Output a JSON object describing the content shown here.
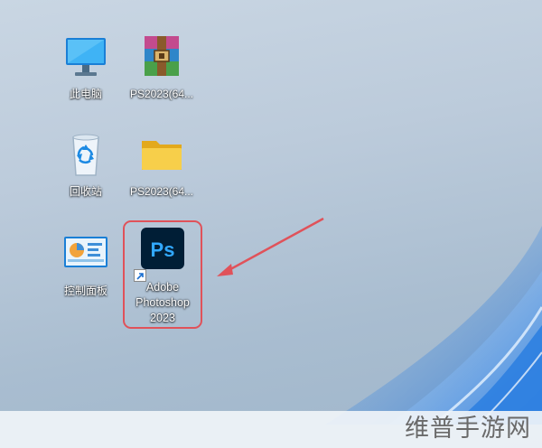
{
  "desktop": {
    "icons": [
      {
        "label": "此电脑",
        "icon": "monitor-icon"
      },
      {
        "label": "PS2023(64...",
        "icon": "archive-icon"
      },
      {
        "label": "回收站",
        "icon": "recycle-bin-icon"
      },
      {
        "label": "PS2023(64...",
        "icon": "folder-icon"
      },
      {
        "label": "控制面板",
        "icon": "control-panel-icon"
      },
      {
        "label_lines": [
          "Adobe",
          "Photoshop",
          "2023"
        ],
        "icon": "photoshop-icon",
        "badge": "Ps",
        "shortcut": true
      }
    ]
  },
  "watermark": "维普手游网",
  "colors": {
    "highlight_border": "#e0525a",
    "photoshop_bg": "#001e36",
    "photoshop_text": "#31a8ff"
  }
}
